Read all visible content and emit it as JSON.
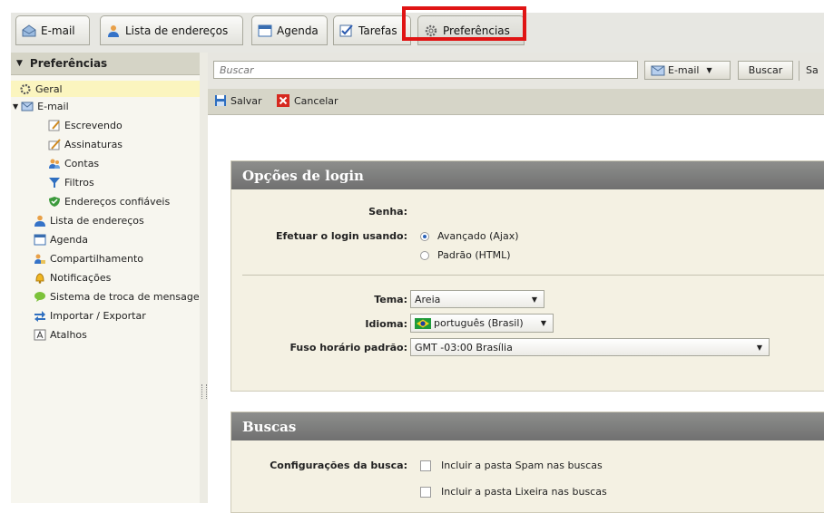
{
  "tabs": [
    {
      "label": "E-mail",
      "icon": "mail-icon"
    },
    {
      "label": "Lista de endereços",
      "icon": "contacts-icon"
    },
    {
      "label": "Agenda",
      "icon": "calendar-icon"
    },
    {
      "label": "Tarefas",
      "icon": "tasks-icon"
    },
    {
      "label": "Preferências",
      "icon": "gear-icon"
    }
  ],
  "sidebar": {
    "title": "Preferências",
    "items": [
      {
        "label": "Geral"
      },
      {
        "label": "E-mail"
      },
      {
        "label": "Escrevendo"
      },
      {
        "label": "Assinaturas"
      },
      {
        "label": "Contas"
      },
      {
        "label": "Filtros"
      },
      {
        "label": "Endereços confiáveis"
      },
      {
        "label": "Lista de endereços"
      },
      {
        "label": "Agenda"
      },
      {
        "label": "Compartilhamento"
      },
      {
        "label": "Notificações"
      },
      {
        "label": "Sistema de troca de mensagens"
      },
      {
        "label": "Importar / Exportar"
      },
      {
        "label": "Atalhos"
      }
    ]
  },
  "search": {
    "placeholder": "Buscar",
    "scope_label": "E-mail",
    "button_label": "Buscar",
    "extra_label": "Sa"
  },
  "toolbar": {
    "save_label": "Salvar",
    "cancel_label": "Cancelar"
  },
  "login_section": {
    "title": "Opções de login",
    "password_label": "Senha:",
    "login_using_label": "Efetuar o login usando:",
    "option_advanced": "Avançado (Ajax)",
    "option_standard": "Padrão (HTML)",
    "selected": "Avançado (Ajax)",
    "theme_label": "Tema:",
    "theme_value": "Areia",
    "language_label": "Idioma:",
    "language_value": "português (Brasil)",
    "timezone_label": "Fuso horário padrão:",
    "timezone_value": "GMT -03:00 Brasília"
  },
  "search_section": {
    "title": "Buscas",
    "config_label": "Configurações da busca:",
    "option_spam": "Incluir a pasta Spam nas buscas",
    "option_trash": "Incluir a pasta Lixeira nas buscas"
  },
  "colors": {
    "highlight_box": "#e01414",
    "section_header": "#7a7a78",
    "selected_item": "#fbf5bf"
  }
}
